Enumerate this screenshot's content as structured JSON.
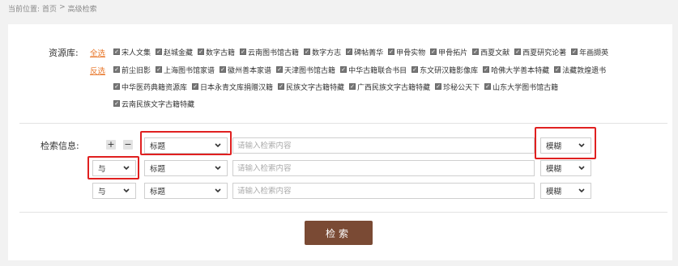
{
  "breadcrumb": {
    "prefix": "当前位置:",
    "home": "首页",
    "sep": ">",
    "current": "高级检索"
  },
  "sources": {
    "label": "资源库:",
    "select_all": "全选",
    "invert": "反选",
    "rows": [
      [
        "宋人文集",
        "赵城金藏",
        "数字古籍",
        "云南图书馆古籍",
        "数字方志",
        "碑帖菁华",
        "甲骨实物",
        "甲骨拓片",
        "西夏文献",
        "西夏研究论著",
        "年画撷英"
      ],
      [
        "前尘旧影",
        "上海图书馆家谱",
        "徽州善本家谱",
        "天津图书馆古籍",
        "中华古籍联合书目",
        "东文研汉籍影像库",
        "哈佛大学善本特藏",
        "法藏敦煌遗书"
      ],
      [
        "中华医药典籍资源库",
        "日本永青文库捐赠汉籍",
        "民族文字古籍特藏",
        "广西民族文字古籍特藏",
        "珍秘公天下",
        "山东大学图书馆古籍"
      ],
      [
        "云南民族文字古籍特藏"
      ]
    ]
  },
  "search": {
    "label": "检索信息:",
    "plus": "+",
    "minus": "−",
    "rows": [
      {
        "field": "标题",
        "placeholder": "请输入检索内容",
        "mode": "模糊"
      },
      {
        "logic": "与",
        "field": "标题",
        "placeholder": "请输入检索内容",
        "mode": "模糊"
      },
      {
        "logic": "与",
        "field": "标题",
        "placeholder": "请输入检索内容",
        "mode": "模糊"
      }
    ],
    "button": "检索"
  },
  "colors": {
    "accent": "#7a4a34",
    "link": "#e8782c",
    "highlight": "#e02020"
  },
  "icons": {
    "checkbox": "checkbox-checked-icon",
    "dropdown": "chevron-down-icon"
  }
}
